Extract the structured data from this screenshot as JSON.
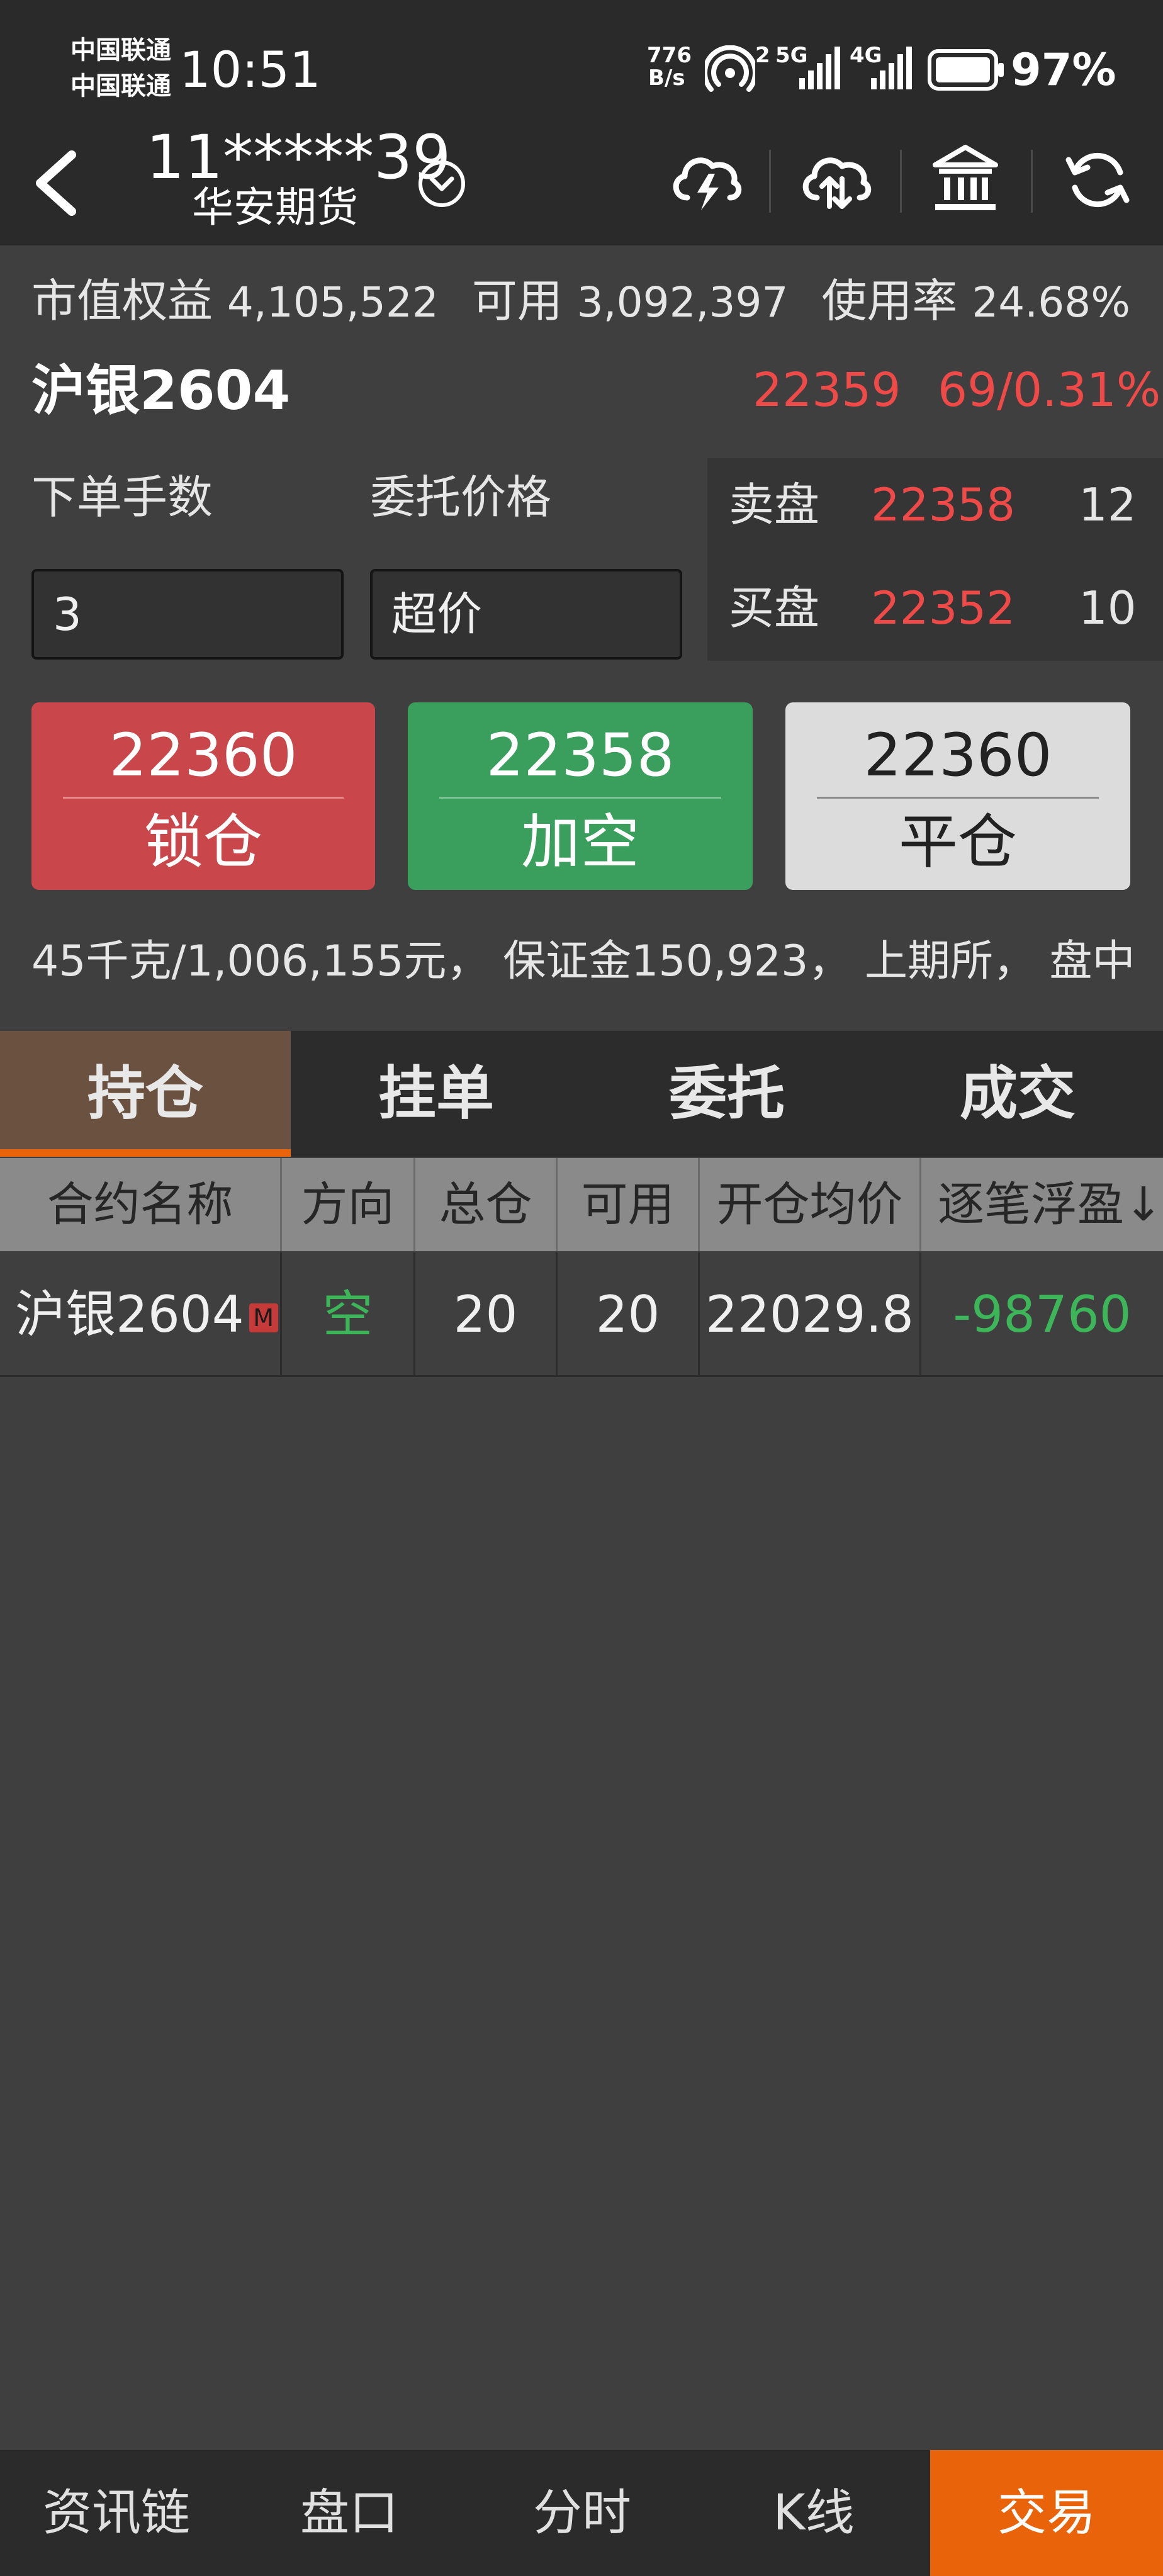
{
  "status_bar": {
    "carrier1": "中国联通",
    "carrier2": "中国联通",
    "time": "10:51",
    "net_speed_top": "776",
    "net_speed_bottom": "B/s",
    "hotspot_count": "2",
    "signal1": "5G",
    "signal2": "4G",
    "battery": "97%"
  },
  "header": {
    "account": "11*****39",
    "broker": "华安期货",
    "icons": [
      "back-icon",
      "chevron-down-circle-icon",
      "cloud-lightning-icon",
      "cloud-sync-icon",
      "bank-icon",
      "refresh-icon"
    ]
  },
  "account_summary": {
    "equity_label": "市值权益",
    "equity_value": "4,105,522",
    "available_label": "可用",
    "available_value": "3,092,397",
    "usage_label": "使用率",
    "usage_value": "24.68%"
  },
  "contract": {
    "name": "沪银2604",
    "last_price": "22359",
    "change": "69/0.31%"
  },
  "order_form": {
    "qty_label": "下单手数",
    "qty_value": "3",
    "price_label": "委托价格",
    "price_value": "超价"
  },
  "depth": {
    "ask_label": "卖盘",
    "ask_price": "22358",
    "ask_volume": "12",
    "bid_label": "买盘",
    "bid_price": "22352",
    "bid_volume": "10"
  },
  "buttons": {
    "lock": {
      "price": "22360",
      "label": "锁仓"
    },
    "add_short": {
      "price": "22358",
      "label": "加空"
    },
    "close": {
      "price": "22360",
      "label": "平仓"
    }
  },
  "contract_info": "45千克/1,006,155元， 保证金150,923， 上期所， 盘中",
  "tabs": [
    "持仓",
    "挂单",
    "委托",
    "成交"
  ],
  "active_tab": "持仓",
  "positions": {
    "headers": [
      "合约名称",
      "方向",
      "总仓",
      "可用",
      "开仓均价",
      "逐笔浮盈"
    ],
    "sort_indicator": "↓",
    "rows": [
      {
        "name": "沪银2604",
        "badge": "M",
        "direction": "空",
        "total": "20",
        "available": "20",
        "avg_price": "22029.8",
        "pnl": "-98760"
      }
    ]
  },
  "bottom_nav": [
    "资讯链",
    "盘口",
    "分时",
    "K线",
    "交易"
  ],
  "active_nav": "交易",
  "colors": {
    "accent_orange": "#e9630a",
    "up_red": "#ef4a48",
    "down_green": "#3db65a",
    "lock_button": "#c9474a",
    "short_button": "#3a9e5d",
    "close_button": "#dcdcdc"
  }
}
